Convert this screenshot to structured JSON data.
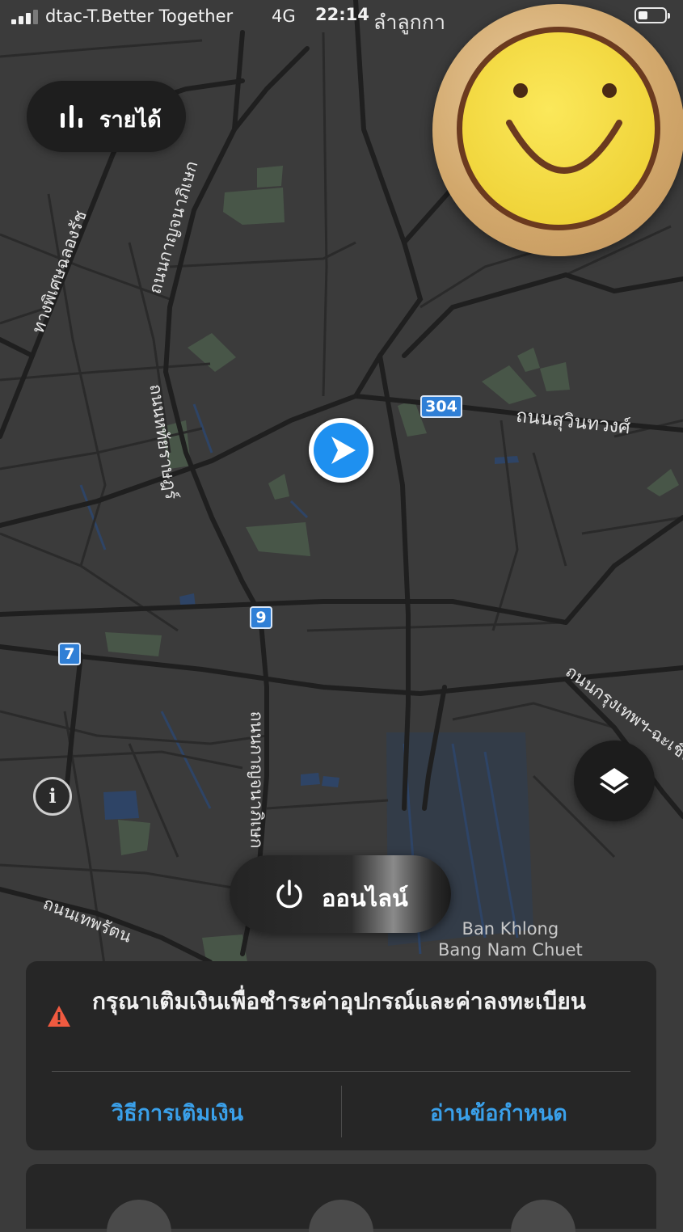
{
  "status_bar": {
    "carrier": "dtac-T.Better Together",
    "network": "4G",
    "time": "22:14"
  },
  "earnings_button": {
    "label": "รายได้",
    "icon": "bar-chart-icon"
  },
  "sticker": {
    "icon": "smiley-face-icon"
  },
  "map": {
    "road_labels": [
      "ลำลูกกา",
      "ถนนกาญจนาภิเษก",
      "ทางพิเศษฉลองรัช",
      "ถนนสุวินทวงศ์",
      "ถนนหทัยราษฎร์",
      "ถนนกาญจนาภิเษก",
      "ถนนกรุงเทพฯ-ฉะเชิงเทรา",
      "ถนนเทพรัตน"
    ],
    "place_label": [
      "Ban Khlong",
      "Bang Nam Chuet"
    ],
    "route_shields": [
      "304",
      "9",
      "7"
    ]
  },
  "location_marker": {
    "icon": "navigation-arrow-icon"
  },
  "info_button": {
    "label": "i"
  },
  "layers_button": {
    "icon": "layers-icon"
  },
  "online_button": {
    "label": "ออนไลน์",
    "icon": "power-icon"
  },
  "notice": {
    "icon": "warning-icon",
    "message": "กรุณาเติมเงินเพื่อชำระค่าอุปกรณ์และค่าลงทะเบียน",
    "left_link": "วิธีการเติมเงิน",
    "right_link": "อ่านข้อกำหนด"
  },
  "colors": {
    "map_background": "#3b3b3b",
    "road": "#222222",
    "park": "#4a5a4a",
    "water": "#2e4466",
    "accent_blue": "#1e90f0",
    "link_blue": "#3aa0ea",
    "warning_red": "#f05a40"
  }
}
